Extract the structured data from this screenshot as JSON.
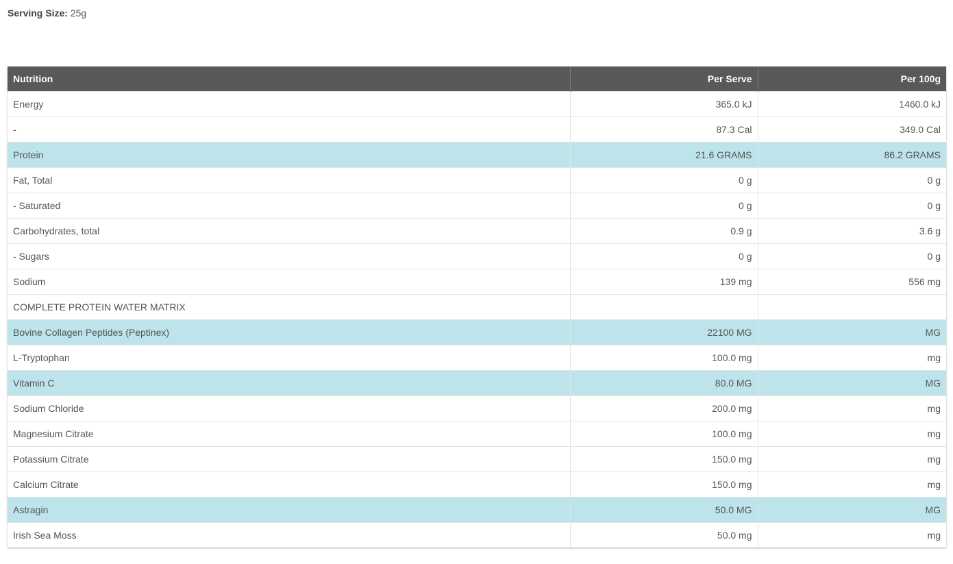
{
  "serving": {
    "label": "Serving Size:",
    "value": "25g"
  },
  "table": {
    "headers": [
      "Nutrition",
      "Per Serve",
      "Per 100g"
    ],
    "rows": [
      {
        "name": "Energy",
        "per_serve": "365.0 kJ",
        "per_100g": "1460.0 kJ",
        "highlight": false
      },
      {
        "name": "-",
        "per_serve": "87.3 Cal",
        "per_100g": "349.0 Cal",
        "highlight": false
      },
      {
        "name": "Protein",
        "per_serve": "21.6 GRAMS",
        "per_100g": "86.2 GRAMS",
        "highlight": true
      },
      {
        "name": "Fat, Total",
        "per_serve": "0 g",
        "per_100g": "0 g",
        "highlight": false
      },
      {
        "name": "- Saturated",
        "per_serve": "0 g",
        "per_100g": "0 g",
        "highlight": false
      },
      {
        "name": "Carbohydrates, total",
        "per_serve": "0.9 g",
        "per_100g": "3.6 g",
        "highlight": false
      },
      {
        "name": "- Sugars",
        "per_serve": "0 g",
        "per_100g": "0 g",
        "highlight": false
      },
      {
        "name": "Sodium",
        "per_serve": "139 mg",
        "per_100g": "556 mg",
        "highlight": false
      },
      {
        "name": "COMPLETE PROTEIN WATER MATRIX",
        "per_serve": "",
        "per_100g": "",
        "highlight": false
      },
      {
        "name": "Bovine Collagen Peptides (Peptinex)",
        "per_serve": "22100 MG",
        "per_100g": "MG",
        "highlight": true
      },
      {
        "name": "L-Tryptophan",
        "per_serve": "100.0 mg",
        "per_100g": "mg",
        "highlight": false
      },
      {
        "name": "Vitamin C",
        "per_serve": "80.0 MG",
        "per_100g": "MG",
        "highlight": true
      },
      {
        "name": "Sodium Chloride",
        "per_serve": "200.0 mg",
        "per_100g": "mg",
        "highlight": false
      },
      {
        "name": "Magnesium Citrate",
        "per_serve": "100.0 mg",
        "per_100g": "mg",
        "highlight": false
      },
      {
        "name": "Potassium Citrate",
        "per_serve": "150.0 mg",
        "per_100g": "mg",
        "highlight": false
      },
      {
        "name": "Calcium Citrate",
        "per_serve": "150.0 mg",
        "per_100g": "mg",
        "highlight": false
      },
      {
        "name": "Astragin",
        "per_serve": "50.0 MG",
        "per_100g": "MG",
        "highlight": true
      },
      {
        "name": "Irish Sea Moss",
        "per_serve": "50.0 mg",
        "per_100g": "mg",
        "highlight": false
      }
    ]
  },
  "colors": {
    "header_bg": "#595959",
    "highlight_row": "#bde4ea"
  }
}
